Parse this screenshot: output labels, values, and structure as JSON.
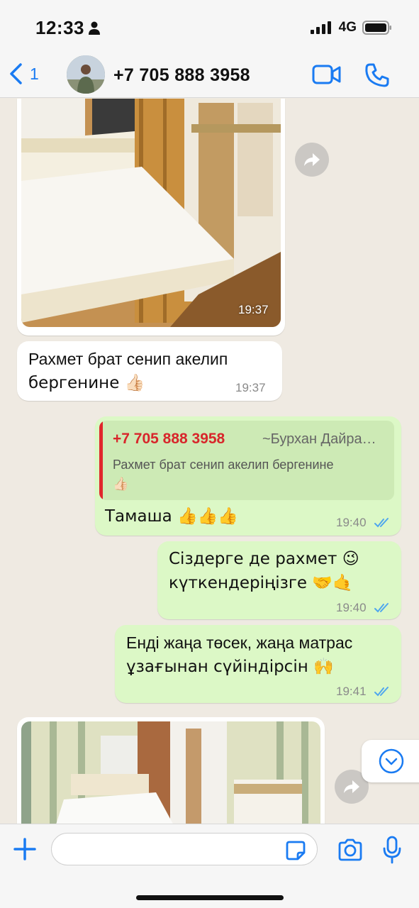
{
  "status_bar": {
    "time": "12:33",
    "network": "4G"
  },
  "header": {
    "back_count": "1",
    "contact_name": "+7 705 888 3958"
  },
  "messages": [
    {
      "type": "photo",
      "direction": "in",
      "time": "19:37"
    },
    {
      "type": "text",
      "direction": "in",
      "text": "Рахмет брат сенип акелип бергенине 👍🏻",
      "line1": "Рахмет брат сенип акелип",
      "line2": "бергенине 👍🏻",
      "time": "19:37"
    },
    {
      "type": "reply",
      "direction": "out",
      "quote_phone": "+7 705 888 3958",
      "quote_author": "~Бурхан Дайра…",
      "quote_line1": "Рахмет брат сенип акелип бергенине",
      "quote_line2": "👍🏻",
      "text": "Тамаша 👍👍👍",
      "time": "19:40"
    },
    {
      "type": "text",
      "direction": "out",
      "line1": "Сіздерге де рахмет 😉",
      "line2": "күткендеріңізге 🤝🤙",
      "time": "19:40"
    },
    {
      "type": "text",
      "direction": "out",
      "line1": "Енді жаңа төсек, жаңа матрас",
      "line2": "ұзағынан сүйіндірсін 🙌",
      "time": "19:41"
    },
    {
      "type": "photo",
      "direction": "in"
    }
  ],
  "input": {
    "placeholder": ""
  },
  "colors": {
    "accent": "#1a7bf2",
    "out_bubble": "#dcf8c6",
    "quote_name": "#d8262b",
    "read_ticks": "#4fa6ee"
  },
  "icons": [
    "chevron-left-icon",
    "video-camera-icon",
    "phone-icon",
    "forward-icon",
    "chevron-down-icon",
    "plus-icon",
    "sticker-icon",
    "camera-icon",
    "microphone-icon",
    "double-check-icon"
  ]
}
